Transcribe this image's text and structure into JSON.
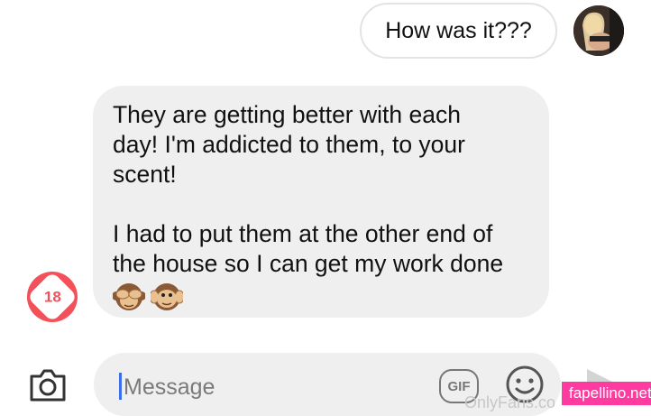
{
  "conversation": {
    "outgoing": {
      "text": "How was it???"
    },
    "incoming": {
      "paragraph1": "They are getting better with each\nday! I'm addicted to them, to your\nscent!",
      "paragraph2": "I had to put them at the other end of\nthe house so I can get my work done",
      "emojis": [
        "see-no-evil-monkey",
        "hear-no-evil-monkey"
      ]
    },
    "badge": {
      "text": "18"
    }
  },
  "composer": {
    "placeholder": "Message",
    "gif_label": "GIF"
  },
  "watermarks": {
    "onlyfans": "OnlyFans.co",
    "site": "fapellino.net"
  },
  "colors": {
    "incoming_bubble": "#efefef",
    "badge": "#f4505a",
    "caret": "#3a6cf0",
    "watermark": "#ff3aa0"
  }
}
